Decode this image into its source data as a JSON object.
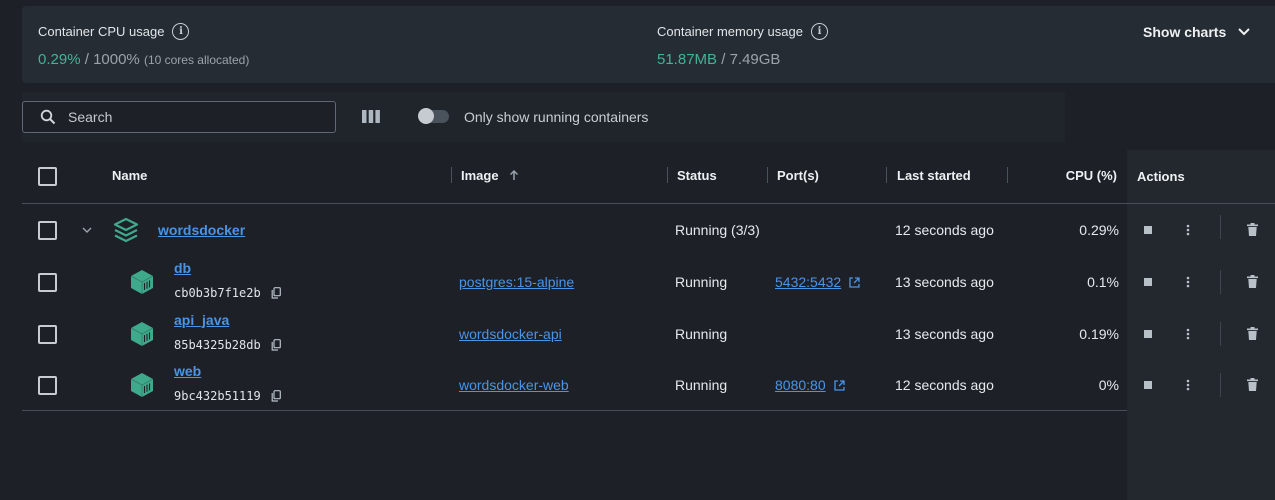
{
  "stats": {
    "cpu_label": "Container CPU usage",
    "cpu_used": "0.29%",
    "cpu_sep": " / ",
    "cpu_total": "1000%",
    "cpu_cores": "(10 cores allocated)",
    "mem_label": "Container memory usage",
    "mem_used": "51.87MB",
    "mem_sep": " / ",
    "mem_total": "7.49GB",
    "show_charts": "Show charts"
  },
  "toolbar": {
    "search_placeholder": "Search",
    "toggle_label": "Only show running containers",
    "toggle_on": false
  },
  "table": {
    "headers": {
      "name": "Name",
      "image": "Image",
      "status": "Status",
      "ports": "Port(s)",
      "last_started": "Last started",
      "cpu": "CPU (%)",
      "actions": "Actions"
    },
    "group": {
      "name": "wordsdocker",
      "status": "Running (3/3)",
      "last_started": "12 seconds ago",
      "cpu": "0.29%"
    },
    "rows": [
      {
        "name": "db",
        "id": "cb0b3b7f1e2b",
        "image": "postgres:15-alpine",
        "status": "Running",
        "ports": "5432:5432",
        "last_started": "13 seconds ago",
        "cpu": "0.1%"
      },
      {
        "name": "api_java",
        "id": "85b4325b28db",
        "image": "wordsdocker-api",
        "status": "Running",
        "ports": "",
        "last_started": "13 seconds ago",
        "cpu": "0.19%"
      },
      {
        "name": "web",
        "id": "9bc432b51119",
        "image": "wordsdocker-web",
        "status": "Running",
        "ports": "8080:80",
        "last_started": "12 seconds ago",
        "cpu": "0%"
      }
    ]
  },
  "colors": {
    "accent_green": "#40b494",
    "link_blue": "#4a94e8",
    "background": "#1d2127"
  }
}
